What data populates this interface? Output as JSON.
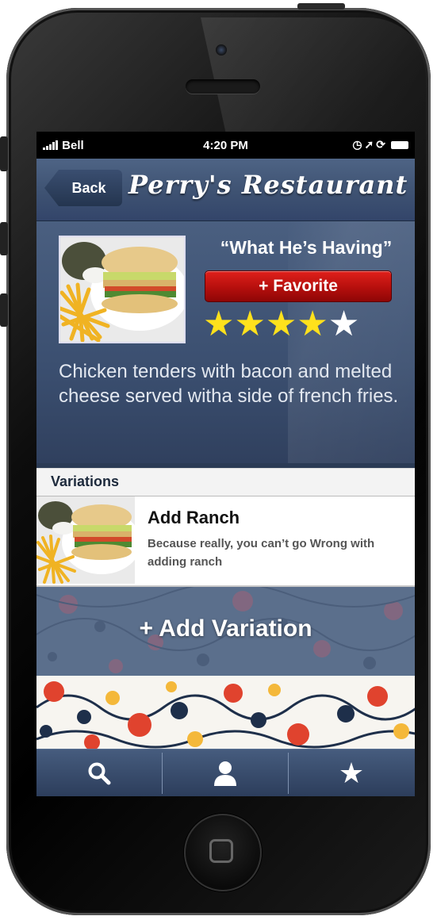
{
  "status_bar": {
    "carrier": "Bell",
    "time": "4:20 PM",
    "icons": [
      "signal-icon",
      "clock-icon",
      "location-icon",
      "lock-rotation-icon",
      "battery-icon"
    ]
  },
  "nav": {
    "back_label": "Back",
    "title": "Perry's Restaurant"
  },
  "dish": {
    "title": "“What He’s Having”",
    "favorite_label": "+ Favorite",
    "rating": 4,
    "rating_max": 5,
    "description": "Chicken tenders with bacon and melted cheese served witha side of french fries."
  },
  "variations": {
    "header": "Variations",
    "items": [
      {
        "title": "Add Ranch",
        "description": "Because really, you can’t go Wrong with adding ranch"
      }
    ],
    "add_label": "+ Add Variation"
  },
  "tabs": [
    {
      "icon": "search-icon"
    },
    {
      "icon": "person-icon"
    },
    {
      "icon": "star-icon"
    }
  ],
  "colors": {
    "nav_blue": "#3e5272",
    "favorite_red": "#c81512",
    "star_gold": "#ffe11c"
  }
}
